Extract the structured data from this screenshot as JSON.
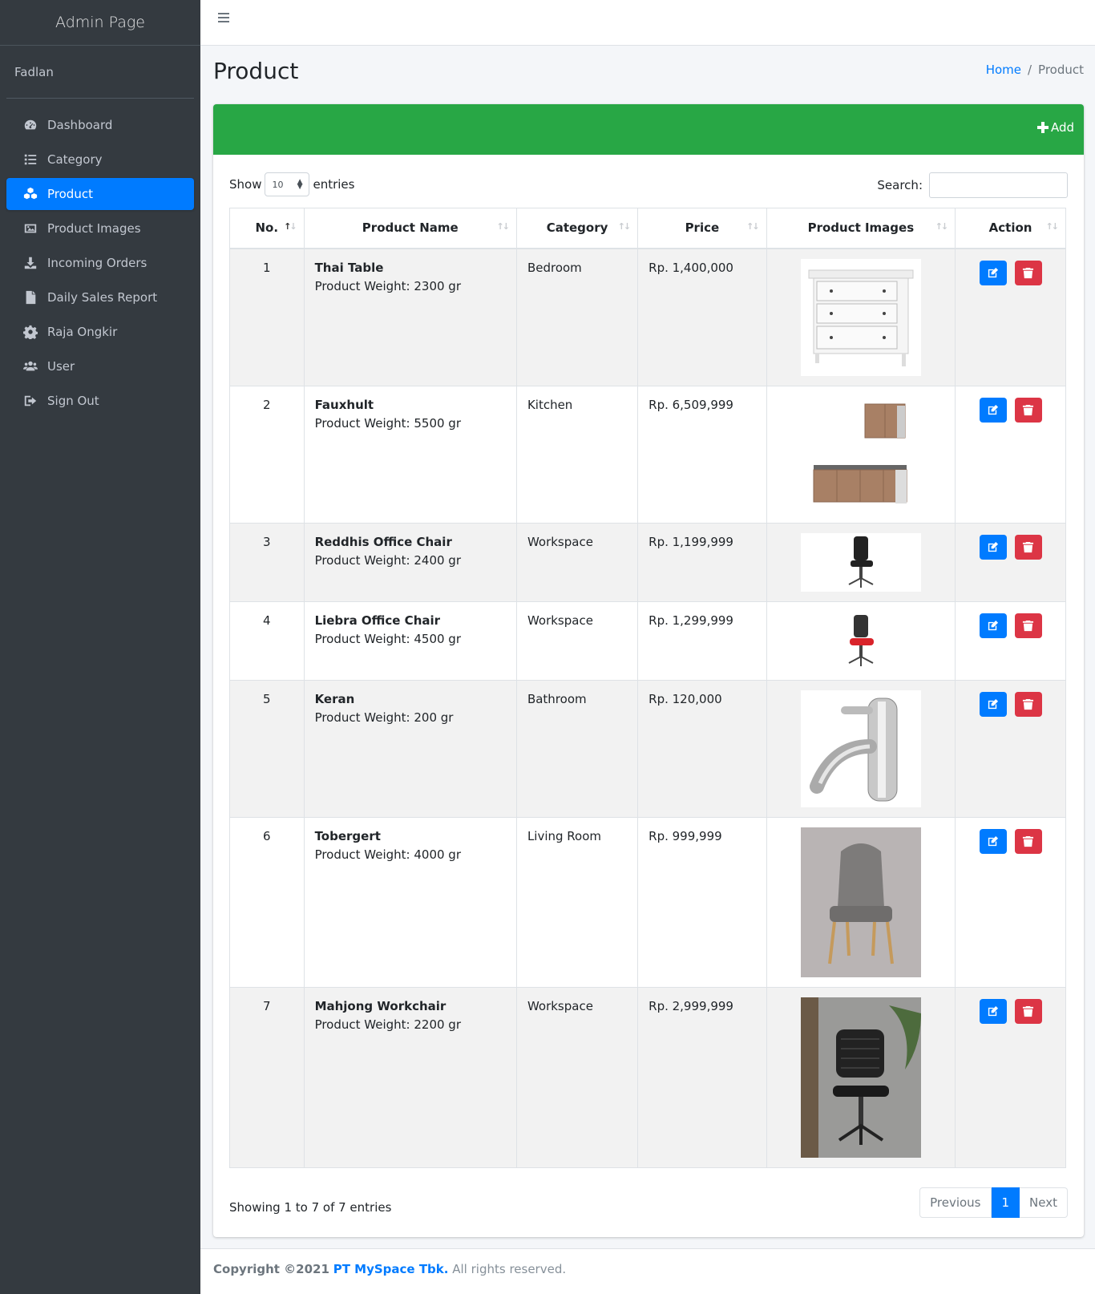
{
  "brand": "Admin Page",
  "user_name": "Fadlan",
  "nav": [
    {
      "label": "Dashboard",
      "icon": "dashboard-icon"
    },
    {
      "label": "Category",
      "icon": "list-icon"
    },
    {
      "label": "Product",
      "icon": "cubes-icon",
      "active": true
    },
    {
      "label": "Product Images",
      "icon": "image-icon"
    },
    {
      "label": "Incoming Orders",
      "icon": "download-icon"
    },
    {
      "label": "Daily Sales Report",
      "icon": "file-icon"
    },
    {
      "label": "Raja Ongkir",
      "icon": "gear-icon"
    },
    {
      "label": "User",
      "icon": "users-icon"
    },
    {
      "label": "Sign Out",
      "icon": "sign-out-icon"
    }
  ],
  "page_title": "Product",
  "breadcrumb": {
    "home": "Home",
    "sep": "/",
    "current": "Product"
  },
  "add_label": "Add",
  "show_label": "Show",
  "entries_value": "10",
  "entries_label": "entries",
  "search_label": "Search:",
  "columns": [
    "No.",
    "Product Name",
    "Category",
    "Price",
    "Product Images",
    "Action"
  ],
  "rows": [
    {
      "no": "1",
      "name": "Thai Table",
      "weight": "Product Weight: 2300 gr",
      "category": "Bedroom",
      "price": "Rp. 1,400,000",
      "image": "dresser"
    },
    {
      "no": "2",
      "name": "Fauxhult",
      "weight": "Product Weight: 5500 gr",
      "category": "Kitchen",
      "price": "Rp. 6,509,999",
      "image": "kitchen"
    },
    {
      "no": "3",
      "name": "Reddhis Office Chair",
      "weight": "Product Weight: 2400 gr",
      "category": "Workspace",
      "price": "Rp. 1,199,999",
      "image": "office-chair-black"
    },
    {
      "no": "4",
      "name": "Liebra Office Chair",
      "weight": "Product Weight: 4500 gr",
      "category": "Workspace",
      "price": "Rp. 1,299,999",
      "image": "office-chair-red"
    },
    {
      "no": "5",
      "name": "Keran",
      "weight": "Product Weight: 200 gr",
      "category": "Bathroom",
      "price": "Rp. 120,000",
      "image": "faucet"
    },
    {
      "no": "6",
      "name": "Tobergert",
      "weight": "Product Weight: 4000 gr",
      "category": "Living Room",
      "price": "Rp. 999,999",
      "image": "armchair"
    },
    {
      "no": "7",
      "name": "Mahjong Workchair",
      "weight": "Product Weight: 2200 gr",
      "category": "Workspace",
      "price": "Rp. 2,999,999",
      "image": "workchair"
    }
  ],
  "info": "Showing 1 to 7 of 7 entries",
  "pagination": {
    "prev": "Previous",
    "page": "1",
    "next": "Next"
  },
  "footer": {
    "copyright": "Copyright ©2021",
    "company": "PT MySpace Tbk.",
    "rights": "All rights reserved."
  },
  "colors": {
    "sidebar": "#343a40",
    "primary": "#007bff",
    "success": "#28a745",
    "danger": "#dc3545"
  }
}
